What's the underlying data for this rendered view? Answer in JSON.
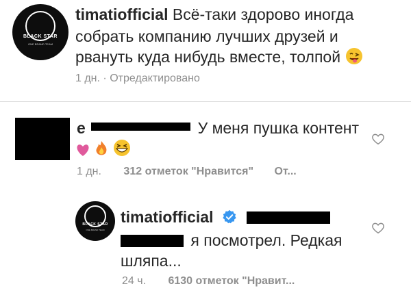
{
  "caption": {
    "username": "timatiofficial",
    "line1": "Всё-таки здорово иногда",
    "line2": "собрать компанию лучших друзей и",
    "line3": "рвануть куда нибудь вместе, толпой",
    "emoji": "face-with-tongue-emoji",
    "time": "1 дн.",
    "edited": "· Отредактировано",
    "avatar_brand": "BLACK STAR",
    "avatar_sub": "ONE BRAND TEAM"
  },
  "comment": {
    "username_fragment": "e",
    "text": "У меня пушка контент",
    "emojis": [
      "pink-heart-emoji",
      "fire-emoji",
      "grinning-squinting-face-emoji"
    ],
    "time": "1 дн.",
    "likes": "312 отметок \"Нравится\"",
    "reply": "От..."
  },
  "reply": {
    "username": "timatiofficial",
    "line1": "я посмотрел. Редкая",
    "line2": "шляпа...",
    "time": "24 ч.",
    "likes": "6130 отметок \"Нравит...",
    "avatar_brand": "BLACK STAR",
    "avatar_sub": "ONE BRAND TEAM"
  },
  "colors": {
    "text": "#262626",
    "meta": "#8e8e8e",
    "verified": "#3897f0",
    "divider": "#dbdbdb"
  }
}
